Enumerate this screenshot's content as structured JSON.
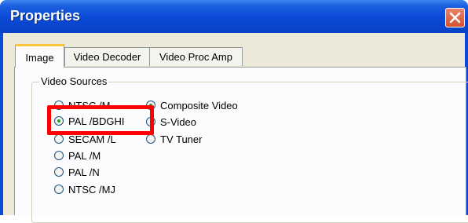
{
  "window": {
    "title": "Properties"
  },
  "tabs": [
    {
      "label": "Image",
      "active": true
    },
    {
      "label": "Video Decoder",
      "active": false
    },
    {
      "label": "Video Proc Amp",
      "active": false
    }
  ],
  "video_sources": {
    "group_label": "Video Sources",
    "standards": [
      {
        "label": "NTSC /M",
        "checked": false
      },
      {
        "label": "PAL /BDGHI",
        "checked": true
      },
      {
        "label": "SECAM /L",
        "checked": false
      },
      {
        "label": "PAL /M",
        "checked": false
      },
      {
        "label": "PAL /N",
        "checked": false
      },
      {
        "label": "NTSC /MJ",
        "checked": false
      }
    ],
    "inputs": [
      {
        "label": "Composite Video",
        "checked": true
      },
      {
        "label": "S-Video",
        "checked": false
      },
      {
        "label": "TV Tuner",
        "checked": false
      }
    ]
  },
  "colors": {
    "title_bar": "#0a49d6",
    "highlight": "#ff0000",
    "radio_dot": "#21a121"
  }
}
